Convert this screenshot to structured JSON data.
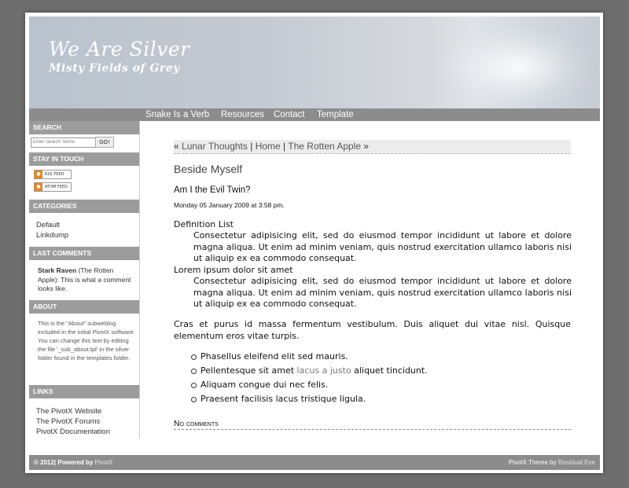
{
  "header": {
    "title": "We Are Silver",
    "subtitle": "Misty Fields of Grey"
  },
  "nav": {
    "items": [
      "Snake Is a Verb",
      "Resources",
      "Contact",
      "Template"
    ]
  },
  "sidebar": {
    "search": {
      "heading": "SEARCH",
      "placeholder": "Enter Search Terms",
      "button": "GO!"
    },
    "touch": {
      "heading": "STAY IN TOUCH",
      "rss": "RSS FEED",
      "atom": "ATOM FEED"
    },
    "categories": {
      "heading": "CATEGORIES",
      "items": [
        "Default",
        "Linkdump"
      ]
    },
    "last_comments": {
      "heading": "LAST COMMENTS",
      "author": "Stark Raven",
      "text": " (The Rotten Apple): This is what a comment looks like."
    },
    "about": {
      "heading": "ABOUT",
      "text": "This is the \"About\" subweblog included in the initial PivotX software. You can change this text by editing the file '_sub_about.tpl' in the silver folder found in the templates folder."
    },
    "links": {
      "heading": "LINKS",
      "items": [
        "The PivotX Website",
        "The PivotX Forums",
        "PivotX Documentation"
      ]
    }
  },
  "content": {
    "crumbs": {
      "prev_arrow": "«",
      "prev": "Lunar Thoughts",
      "sep1": "|",
      "home": "Home",
      "sep2": "|",
      "next": "The Rotten Apple",
      "next_arrow": "»"
    },
    "page_title": "Beside Myself",
    "post_title": "Am I the Evil Twin?",
    "post_date": "Monday 05 January 2009 at 3:58 pm.",
    "dl": [
      {
        "term": "Definition List",
        "def": "Consectetur adipisicing elit, sed do eiusmod tempor incididunt ut labore et dolore magna aliqua. Ut enim ad minim veniam, quis nostrud exercitation ullamco laboris nisi ut aliquip ex ea commodo consequat."
      },
      {
        "term": "Lorem ipsum dolor sit amet",
        "def": "Consectetur adipisicing elit, sed do eiusmod tempor incididunt ut labore et dolore magna aliqua. Ut enim ad minim veniam, quis nostrud exercitation ullamco laboris nisi ut aliquip ex ea commodo consequat."
      }
    ],
    "paragraph": "Cras et purus id massa fermentum vestibulum. Duis aliquet dui vitae nisl. Quisque elementum eros vitae turpis.",
    "bullets": {
      "b1": "Phasellus eleifend elit sed mauris.",
      "b2_a": "Pellentesque sit amet ",
      "b2_link": "lacus a justo",
      "b2_b": " aliquet tincidunt.",
      "b3": "Aliquam congue dui nec felis.",
      "b4": "Praesent facilisis lacus tristique ligula."
    },
    "no_comments": "No comments"
  },
  "footer": {
    "left": "© 2012| Powered by ",
    "left_link": "PivotX",
    "right": "PivotX Theme by ",
    "right_link": "Residual Eve"
  }
}
